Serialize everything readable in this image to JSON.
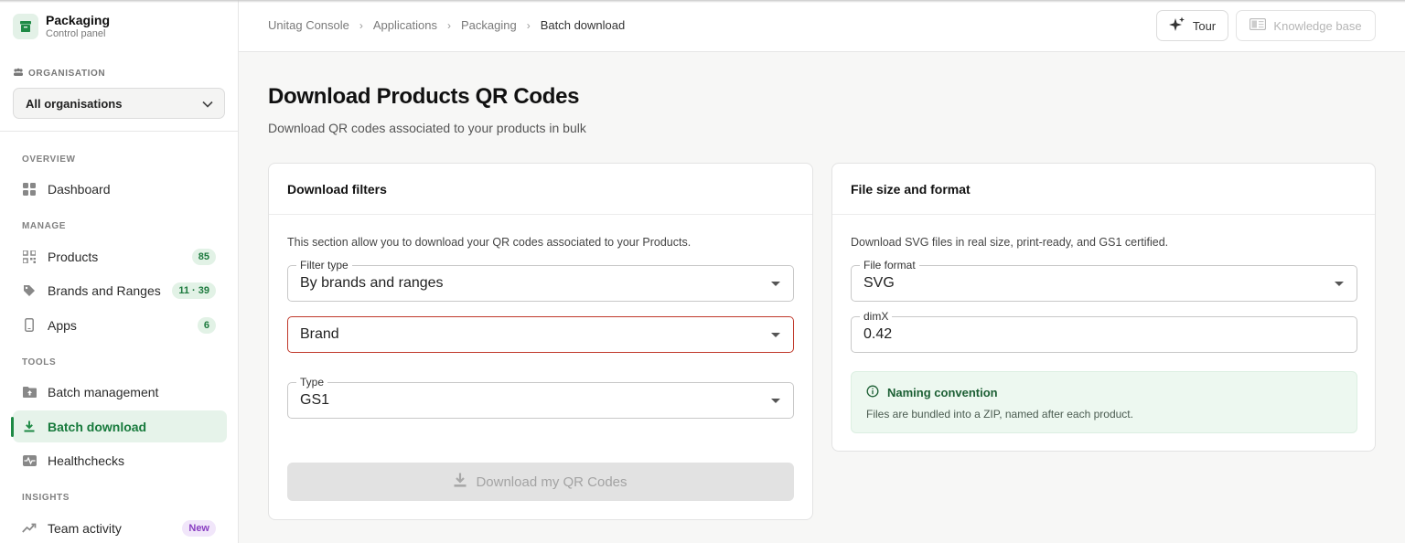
{
  "app": {
    "title": "Packaging",
    "subtitle": "Control panel",
    "accent": "#1e8a45"
  },
  "organisation": {
    "label": "ORGANISATION",
    "selected": "All organisations"
  },
  "sidebar": {
    "sections": [
      {
        "heading": "OVERVIEW",
        "items": [
          {
            "label": "Dashboard",
            "icon": "grid-icon"
          }
        ]
      },
      {
        "heading": "MANAGE",
        "items": [
          {
            "label": "Products",
            "icon": "qr-icon",
            "badge": "85"
          },
          {
            "label": "Brands and Ranges",
            "icon": "tag-icon",
            "badge": "11 · 39"
          },
          {
            "label": "Apps",
            "icon": "phone-icon",
            "badge": "6"
          }
        ]
      },
      {
        "heading": "TOOLS",
        "items": [
          {
            "label": "Batch management",
            "icon": "folder-upload-icon"
          },
          {
            "label": "Batch download",
            "icon": "download-icon",
            "active": true
          }
        ]
      },
      {
        "heading": "",
        "items": [
          {
            "label": "Healthchecks",
            "icon": "pulse-icon"
          }
        ]
      },
      {
        "heading": "INSIGHTS",
        "items": [
          {
            "label": "Team activity",
            "icon": "trend-icon",
            "badge": "New"
          }
        ]
      }
    ]
  },
  "breadcrumbs": [
    "Unitag Console",
    "Applications",
    "Packaging",
    "Batch download"
  ],
  "topbar": {
    "tour_label": "Tour",
    "kb_label": "Knowledge base"
  },
  "page": {
    "title": "Download Products QR Codes",
    "subtitle": "Download QR codes associated to your products in bulk"
  },
  "filters_card": {
    "title": "Download filters",
    "description": "This section allow you to download your QR codes associated to your Products.",
    "filter_type": {
      "label": "Filter type",
      "value": "By brands and ranges"
    },
    "brand": {
      "placeholder": "Brand",
      "error": true
    },
    "type": {
      "label": "Type",
      "value": "GS1"
    },
    "download_label": "Download my QR Codes"
  },
  "format_card": {
    "title": "File size and format",
    "description": "Download SVG files in real size, print-ready, and GS1 certified.",
    "file_format": {
      "label": "File format",
      "value": "SVG"
    },
    "dimx": {
      "label": "dimX",
      "value": "0.42"
    },
    "note": {
      "title": "Naming convention",
      "text": "Files are bundled into a ZIP, named after each product."
    }
  }
}
